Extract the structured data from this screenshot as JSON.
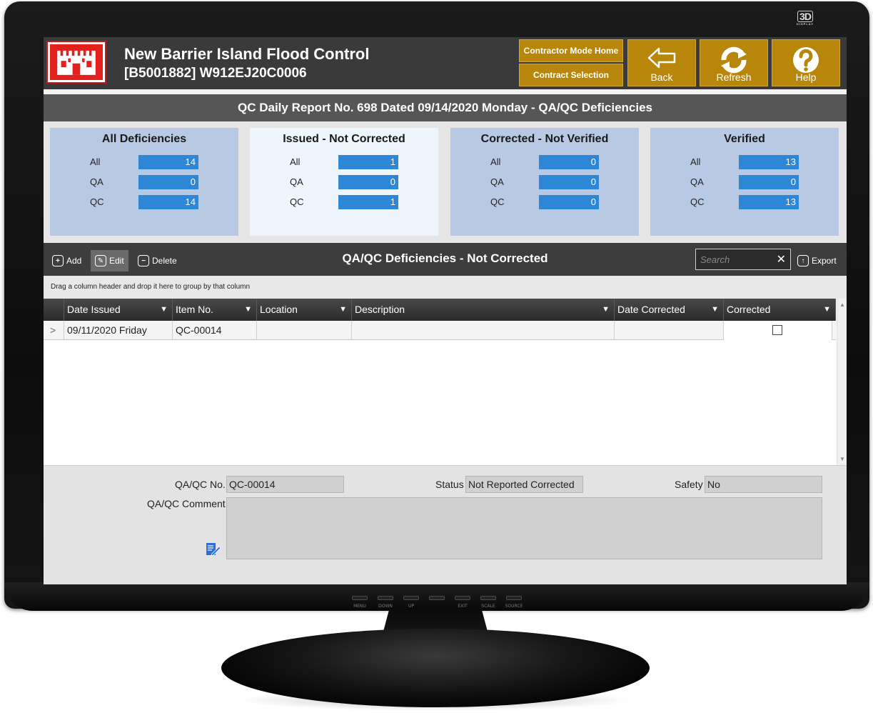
{
  "monitor": {
    "brand_badge": "3D",
    "brand_sub": "DISPLAY",
    "controls": [
      "MENU",
      "DOWN",
      "UP",
      "",
      "EXIT",
      "SCALE",
      "SOURCE"
    ]
  },
  "header": {
    "title": "New Barrier Island Flood Control",
    "subtitle": "[B5001882] W912EJ20C0006",
    "contractor_home_label": "Contractor Mode Home",
    "contract_selection_label": "Contract Selection",
    "back_label": "Back",
    "refresh_label": "Refresh",
    "help_label": "Help",
    "accent_color": "#b8860b"
  },
  "report_title": "QC Daily Report No. 698 Dated 09/14/2020 Monday - QA/QC Deficiencies",
  "summary": [
    {
      "title": "All Deficiencies",
      "rows": [
        {
          "k": "All",
          "v": "14"
        },
        {
          "k": "QA",
          "v": "0"
        },
        {
          "k": "QC",
          "v": "14"
        }
      ]
    },
    {
      "title": "Issued - Not Corrected",
      "rows": [
        {
          "k": "All",
          "v": "1"
        },
        {
          "k": "QA",
          "v": "0"
        },
        {
          "k": "QC",
          "v": "1"
        }
      ]
    },
    {
      "title": "Corrected - Not Verified",
      "rows": [
        {
          "k": "All",
          "v": "0"
        },
        {
          "k": "QA",
          "v": "0"
        },
        {
          "k": "QC",
          "v": "0"
        }
      ]
    },
    {
      "title": "Verified",
      "rows": [
        {
          "k": "All",
          "v": "13"
        },
        {
          "k": "QA",
          "v": "0"
        },
        {
          "k": "QC",
          "v": "13"
        }
      ]
    }
  ],
  "toolbar": {
    "add_label": "Add",
    "edit_label": "Edit",
    "delete_label": "Delete",
    "grid_title": "QA/QC Deficiencies - Not Corrected",
    "search_placeholder": "Search",
    "export_label": "Export"
  },
  "group_hint": "Drag a column header and drop it here to group by that column",
  "grid": {
    "columns": [
      "Date Issued",
      "Item No.",
      "Location",
      "Description",
      "Date Corrected",
      "Corrected"
    ],
    "rows": [
      {
        "expander": ">",
        "date_issued": "09/11/2020 Friday",
        "item_no": "QC-00014",
        "location": "",
        "description": "",
        "date_corrected": "",
        "corrected": false
      }
    ]
  },
  "detail": {
    "qaqc_no_label": "QA/QC No.",
    "qaqc_no_value": "QC-00014",
    "status_label": "Status",
    "status_value": "Not Reported Corrected",
    "safety_label": "Safety",
    "safety_value": "No",
    "comment_label": "QA/QC Comment",
    "comment_value": ""
  }
}
